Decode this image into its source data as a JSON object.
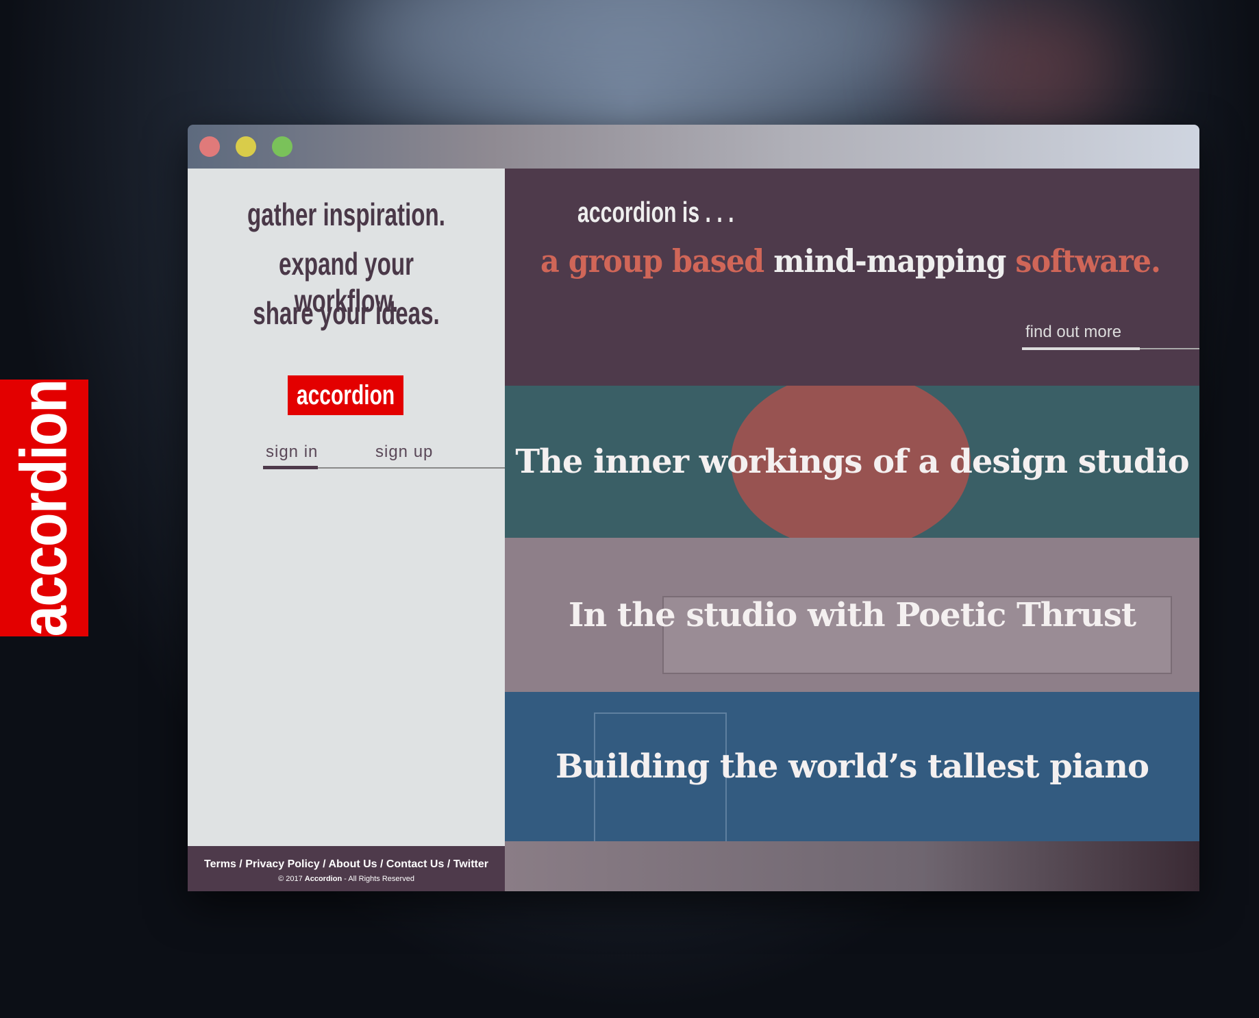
{
  "side_logo": "accordion",
  "window": {
    "dots": [
      "#e07a7a",
      "#d9cc4a",
      "#7ac25a"
    ]
  },
  "left": {
    "taglines": [
      "gather inspiration.",
      "expand your workflow.",
      "share your ideas."
    ],
    "logo": "accordion",
    "tabs": {
      "sign_in": "sign in",
      "sign_up": "sign up",
      "active": "sign in"
    },
    "footer": {
      "links": [
        "Terms",
        "Privacy Policy",
        "About Us",
        "Contact Us",
        "Twitter"
      ],
      "sep": " / ",
      "copy_prefix": "© 2017 ",
      "copy_brand": "Accordion",
      "copy_suffix": " - All Rights Reserved"
    }
  },
  "hero": {
    "intro": "accordion is . . .",
    "headline_a": "a group based",
    "headline_b": " mind-mapping ",
    "headline_c": "software.",
    "find_out_more": "find out more"
  },
  "articles": [
    {
      "title": "The inner workings of a design studio",
      "color": "#3a5f66"
    },
    {
      "title": "In the studio with Poetic Thrust",
      "color": "#8e7f89"
    },
    {
      "title": "Building the world’s tallest piano",
      "color": "#335b80"
    }
  ]
}
